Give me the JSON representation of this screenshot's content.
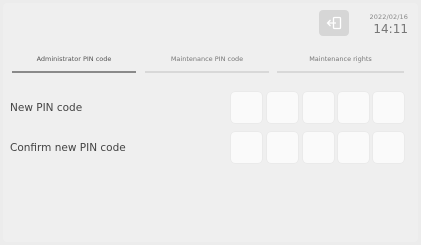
{
  "header": {
    "back_icon": "exit-arrow-icon",
    "date": "2022/02/16",
    "time": "14:11"
  },
  "tabs": [
    {
      "label": "Administrator PIN code",
      "active": true
    },
    {
      "label": "Maintenance PIN code",
      "active": false
    },
    {
      "label": "Maintenance rights",
      "active": false
    }
  ],
  "form": {
    "new_pin_label": "New PIN code",
    "confirm_pin_label": "Confirm new PIN code",
    "new_pin_digits": [
      "",
      "",
      "",
      "",
      ""
    ],
    "confirm_pin_digits": [
      "",
      "",
      "",
      "",
      ""
    ]
  }
}
